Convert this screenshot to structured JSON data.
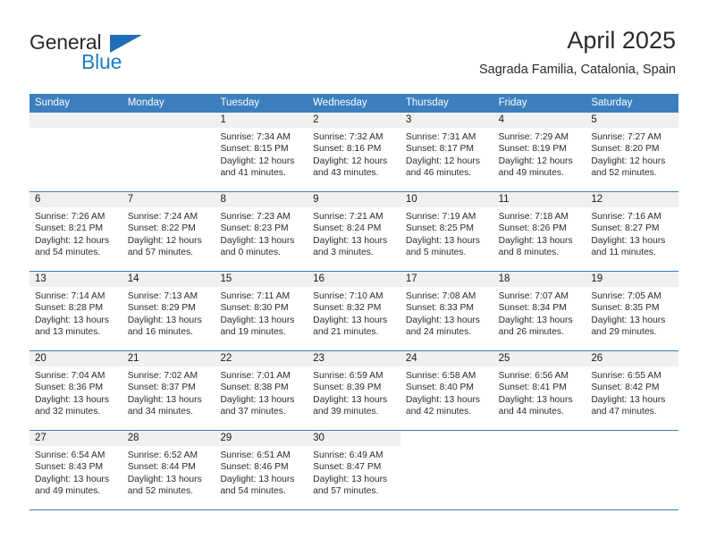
{
  "brand": {
    "word1": "General",
    "word2": "Blue",
    "flag_color": "#1f6db5",
    "blue_color": "#1f7cc4"
  },
  "header": {
    "title": "April 2025",
    "location": "Sagrada Familia, Catalonia, Spain"
  },
  "calendar": {
    "header_bg": "#3b7fbf",
    "daynum_bg": "#f0f0f0",
    "weekdays": [
      "Sunday",
      "Monday",
      "Tuesday",
      "Wednesday",
      "Thursday",
      "Friday",
      "Saturday"
    ],
    "weeks": [
      [
        {
          "day": "",
          "empty": true
        },
        {
          "day": "",
          "empty": true
        },
        {
          "day": "1",
          "sunrise": "Sunrise: 7:34 AM",
          "sunset": "Sunset: 8:15 PM",
          "daylight_line1": "Daylight: 12 hours",
          "daylight_line2": "and 41 minutes."
        },
        {
          "day": "2",
          "sunrise": "Sunrise: 7:32 AM",
          "sunset": "Sunset: 8:16 PM",
          "daylight_line1": "Daylight: 12 hours",
          "daylight_line2": "and 43 minutes."
        },
        {
          "day": "3",
          "sunrise": "Sunrise: 7:31 AM",
          "sunset": "Sunset: 8:17 PM",
          "daylight_line1": "Daylight: 12 hours",
          "daylight_line2": "and 46 minutes."
        },
        {
          "day": "4",
          "sunrise": "Sunrise: 7:29 AM",
          "sunset": "Sunset: 8:19 PM",
          "daylight_line1": "Daylight: 12 hours",
          "daylight_line2": "and 49 minutes."
        },
        {
          "day": "5",
          "sunrise": "Sunrise: 7:27 AM",
          "sunset": "Sunset: 8:20 PM",
          "daylight_line1": "Daylight: 12 hours",
          "daylight_line2": "and 52 minutes."
        }
      ],
      [
        {
          "day": "6",
          "sunrise": "Sunrise: 7:26 AM",
          "sunset": "Sunset: 8:21 PM",
          "daylight_line1": "Daylight: 12 hours",
          "daylight_line2": "and 54 minutes."
        },
        {
          "day": "7",
          "sunrise": "Sunrise: 7:24 AM",
          "sunset": "Sunset: 8:22 PM",
          "daylight_line1": "Daylight: 12 hours",
          "daylight_line2": "and 57 minutes."
        },
        {
          "day": "8",
          "sunrise": "Sunrise: 7:23 AM",
          "sunset": "Sunset: 8:23 PM",
          "daylight_line1": "Daylight: 13 hours",
          "daylight_line2": "and 0 minutes."
        },
        {
          "day": "9",
          "sunrise": "Sunrise: 7:21 AM",
          "sunset": "Sunset: 8:24 PM",
          "daylight_line1": "Daylight: 13 hours",
          "daylight_line2": "and 3 minutes."
        },
        {
          "day": "10",
          "sunrise": "Sunrise: 7:19 AM",
          "sunset": "Sunset: 8:25 PM",
          "daylight_line1": "Daylight: 13 hours",
          "daylight_line2": "and 5 minutes."
        },
        {
          "day": "11",
          "sunrise": "Sunrise: 7:18 AM",
          "sunset": "Sunset: 8:26 PM",
          "daylight_line1": "Daylight: 13 hours",
          "daylight_line2": "and 8 minutes."
        },
        {
          "day": "12",
          "sunrise": "Sunrise: 7:16 AM",
          "sunset": "Sunset: 8:27 PM",
          "daylight_line1": "Daylight: 13 hours",
          "daylight_line2": "and 11 minutes."
        }
      ],
      [
        {
          "day": "13",
          "sunrise": "Sunrise: 7:14 AM",
          "sunset": "Sunset: 8:28 PM",
          "daylight_line1": "Daylight: 13 hours",
          "daylight_line2": "and 13 minutes."
        },
        {
          "day": "14",
          "sunrise": "Sunrise: 7:13 AM",
          "sunset": "Sunset: 8:29 PM",
          "daylight_line1": "Daylight: 13 hours",
          "daylight_line2": "and 16 minutes."
        },
        {
          "day": "15",
          "sunrise": "Sunrise: 7:11 AM",
          "sunset": "Sunset: 8:30 PM",
          "daylight_line1": "Daylight: 13 hours",
          "daylight_line2": "and 19 minutes."
        },
        {
          "day": "16",
          "sunrise": "Sunrise: 7:10 AM",
          "sunset": "Sunset: 8:32 PM",
          "daylight_line1": "Daylight: 13 hours",
          "daylight_line2": "and 21 minutes."
        },
        {
          "day": "17",
          "sunrise": "Sunrise: 7:08 AM",
          "sunset": "Sunset: 8:33 PM",
          "daylight_line1": "Daylight: 13 hours",
          "daylight_line2": "and 24 minutes."
        },
        {
          "day": "18",
          "sunrise": "Sunrise: 7:07 AM",
          "sunset": "Sunset: 8:34 PM",
          "daylight_line1": "Daylight: 13 hours",
          "daylight_line2": "and 26 minutes."
        },
        {
          "day": "19",
          "sunrise": "Sunrise: 7:05 AM",
          "sunset": "Sunset: 8:35 PM",
          "daylight_line1": "Daylight: 13 hours",
          "daylight_line2": "and 29 minutes."
        }
      ],
      [
        {
          "day": "20",
          "sunrise": "Sunrise: 7:04 AM",
          "sunset": "Sunset: 8:36 PM",
          "daylight_line1": "Daylight: 13 hours",
          "daylight_line2": "and 32 minutes."
        },
        {
          "day": "21",
          "sunrise": "Sunrise: 7:02 AM",
          "sunset": "Sunset: 8:37 PM",
          "daylight_line1": "Daylight: 13 hours",
          "daylight_line2": "and 34 minutes."
        },
        {
          "day": "22",
          "sunrise": "Sunrise: 7:01 AM",
          "sunset": "Sunset: 8:38 PM",
          "daylight_line1": "Daylight: 13 hours",
          "daylight_line2": "and 37 minutes."
        },
        {
          "day": "23",
          "sunrise": "Sunrise: 6:59 AM",
          "sunset": "Sunset: 8:39 PM",
          "daylight_line1": "Daylight: 13 hours",
          "daylight_line2": "and 39 minutes."
        },
        {
          "day": "24",
          "sunrise": "Sunrise: 6:58 AM",
          "sunset": "Sunset: 8:40 PM",
          "daylight_line1": "Daylight: 13 hours",
          "daylight_line2": "and 42 minutes."
        },
        {
          "day": "25",
          "sunrise": "Sunrise: 6:56 AM",
          "sunset": "Sunset: 8:41 PM",
          "daylight_line1": "Daylight: 13 hours",
          "daylight_line2": "and 44 minutes."
        },
        {
          "day": "26",
          "sunrise": "Sunrise: 6:55 AM",
          "sunset": "Sunset: 8:42 PM",
          "daylight_line1": "Daylight: 13 hours",
          "daylight_line2": "and 47 minutes."
        }
      ],
      [
        {
          "day": "27",
          "sunrise": "Sunrise: 6:54 AM",
          "sunset": "Sunset: 8:43 PM",
          "daylight_line1": "Daylight: 13 hours",
          "daylight_line2": "and 49 minutes."
        },
        {
          "day": "28",
          "sunrise": "Sunrise: 6:52 AM",
          "sunset": "Sunset: 8:44 PM",
          "daylight_line1": "Daylight: 13 hours",
          "daylight_line2": "and 52 minutes."
        },
        {
          "day": "29",
          "sunrise": "Sunrise: 6:51 AM",
          "sunset": "Sunset: 8:46 PM",
          "daylight_line1": "Daylight: 13 hours",
          "daylight_line2": "and 54 minutes."
        },
        {
          "day": "30",
          "sunrise": "Sunrise: 6:49 AM",
          "sunset": "Sunset: 8:47 PM",
          "daylight_line1": "Daylight: 13 hours",
          "daylight_line2": "and 57 minutes."
        },
        {
          "day": "",
          "blank": true
        },
        {
          "day": "",
          "blank": true
        },
        {
          "day": "",
          "blank": true
        }
      ]
    ]
  }
}
